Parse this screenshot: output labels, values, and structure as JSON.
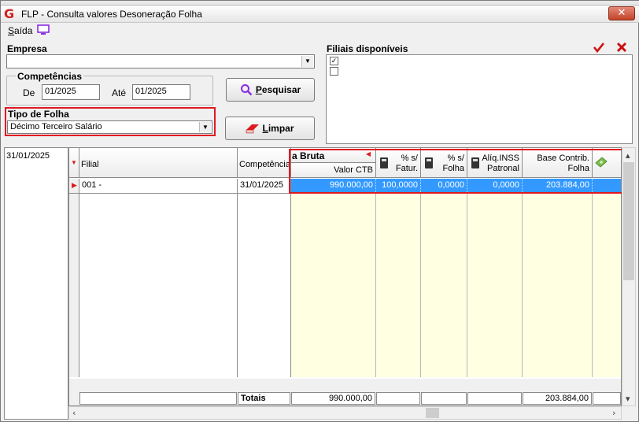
{
  "window": {
    "title": "FLP - Consulta valores Desoneração Folha",
    "close_label": "✕"
  },
  "menu": {
    "saida_prefix": "S",
    "saida_rest": "aída"
  },
  "form": {
    "empresa_label": "Empresa",
    "empresa_value": "",
    "competencias_label": "Competências",
    "de_label": "De",
    "de_value": "01/2025",
    "ate_label": "Até",
    "ate_value": "01/2025",
    "tipo_folha_label": "Tipo de Folha",
    "tipo_folha_value": "Décimo Terceiro Salário",
    "pesquisar_prefix": "P",
    "pesquisar_rest": "esquisar",
    "limpar_prefix": "L",
    "limpar_rest": "impar"
  },
  "filiais": {
    "label": "Filiais disponíveis",
    "items": [
      {
        "checked": true
      },
      {
        "checked": false
      }
    ]
  },
  "dates": [
    "31/01/2025"
  ],
  "grid": {
    "headers": {
      "filial": "Filial",
      "competencia": "Competência",
      "receita_bruta": "a Bruta",
      "valor_ctb": "Valor CTB",
      "pct_fatur_1": "% s/",
      "pct_fatur_2": "Fatur.",
      "pct_folha_1": "% s/",
      "pct_folha_2": "Folha",
      "aliq_1": "Alíq.INSS",
      "aliq_2": "Patronal",
      "base_1": "Base Contrib.",
      "base_2": "Folha"
    },
    "rows": [
      {
        "filial": "001 -",
        "competencia": "31/01/2025",
        "valor_ctb": "990.000,00",
        "pct_fatur": "100,0000",
        "pct_folha": "0,0000",
        "aliq": "0,0000",
        "base": "203.884,00"
      }
    ],
    "totals": {
      "label": "Totais",
      "valor_ctb": "990.000,00",
      "base": "203.884,00"
    }
  },
  "colors": {
    "accent_red": "#e0191f",
    "row_selected": "#3399ff",
    "row_bg": "#ffffe1",
    "close_red": "#c24327"
  }
}
